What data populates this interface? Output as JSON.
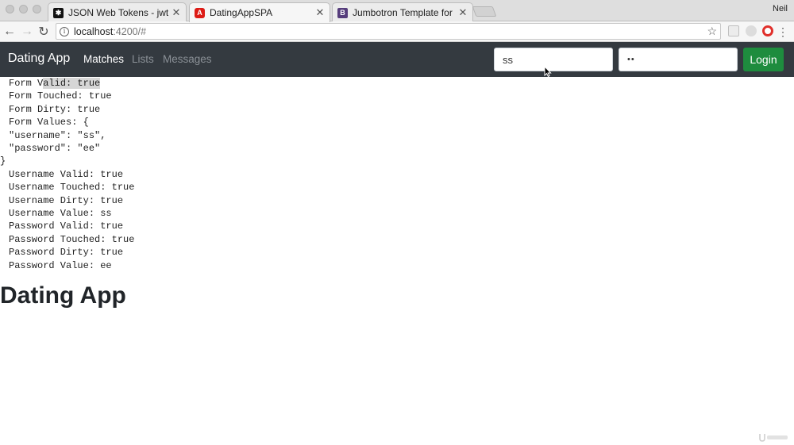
{
  "browser": {
    "tabs": [
      {
        "title": "JSON Web Tokens - jwt.io",
        "icon": "jwt-favicon-icon"
      },
      {
        "title": "DatingAppSPA",
        "icon": "angular-favicon-icon"
      },
      {
        "title": "Jumbotron Template for Boots",
        "icon": "bootstrap-favicon-icon"
      }
    ],
    "profile_name": "Neil",
    "url_host": "localhost",
    "url_path": ":4200/#"
  },
  "navbar": {
    "brand": "Dating App",
    "links": [
      "Matches",
      "Lists",
      "Messages"
    ],
    "username_value": "ss",
    "password_mask": "••",
    "login_label": "Login"
  },
  "debug_lines": [
    "Form Valid: true",
    "Form Touched: true",
    "Form Dirty: true",
    "Form Values: {",
    "\"username\": \"ss\",",
    "\"password\": \"ee\"",
    "}",
    "Username Valid: true",
    "Username Touched: true",
    "Username Dirty: true",
    "Username Value: ss",
    "Password Valid: true",
    "Password Touched: true",
    "Password Dirty: true",
    "Password Value: ee"
  ],
  "debug_highlight": {
    "prefix": "Form V",
    "selected": "alid: true"
  },
  "heading": "Dating App",
  "colors": {
    "navbar_bg": "#343a40",
    "login_button": "#1e8c3e"
  }
}
